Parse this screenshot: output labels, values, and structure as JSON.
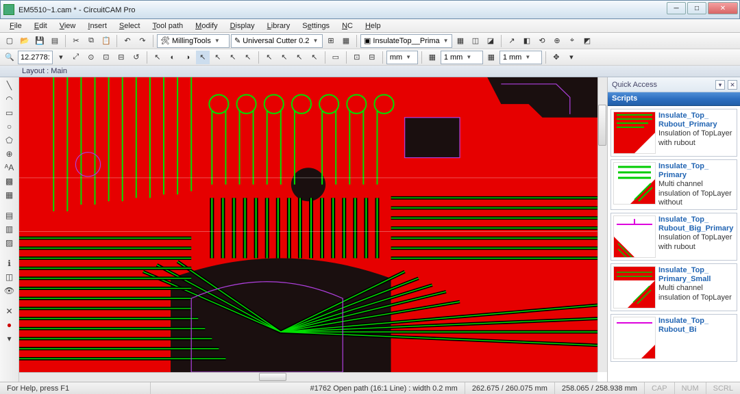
{
  "titlebar": {
    "doc": "EM5510~1.cam *",
    "app": "CircuitCAM Pro"
  },
  "menu": [
    "File",
    "Edit",
    "View",
    "Insert",
    "Select",
    "Tool path",
    "Modify",
    "Display",
    "Library",
    "Settings",
    "NC",
    "Help"
  ],
  "toolbar1": {
    "milling_combo": "MillingTools",
    "cutter_combo": "Universal Cutter 0.2",
    "insulate_combo": "InsulateTop__Prima"
  },
  "toolbar2": {
    "zoom": "12.2778:",
    "unit": "mm",
    "grid1": "1 mm",
    "grid2": "1 mm"
  },
  "layout_label": "Layout : Main",
  "quick_access": {
    "title": "Quick Access",
    "section": "Scripts",
    "cards": [
      {
        "title": "Insulate_Top_Rubout_Primary",
        "desc": "Insulation of TopLayer with rubout",
        "thumb": "redgreen"
      },
      {
        "title": "Insulate_Top_Primary",
        "desc": "Multi channel insulation of TopLayer without",
        "thumb": "greenred"
      },
      {
        "title": "Insulate_Top_Rubout_Big_Primary",
        "desc": "Insulation of TopLayer with rubout",
        "thumb": "magenta"
      },
      {
        "title": "Insulate_Top_Primary_Small",
        "desc": "Multi channel insulation of TopLayer",
        "thumb": "reddiag"
      },
      {
        "title": "Insulate_Top_Rubout_Bi",
        "desc": "",
        "thumb": "mix"
      }
    ]
  },
  "status": {
    "help": "For Help, press F1",
    "object": "#1762 Open path (16:1 Line) : width 0.2 mm",
    "cursor": "262.675 / 260.075 mm",
    "pos2": "258.065 / 258.938 mm",
    "caps": "CAP",
    "num": "NUM",
    "scrl": "SCRL"
  }
}
